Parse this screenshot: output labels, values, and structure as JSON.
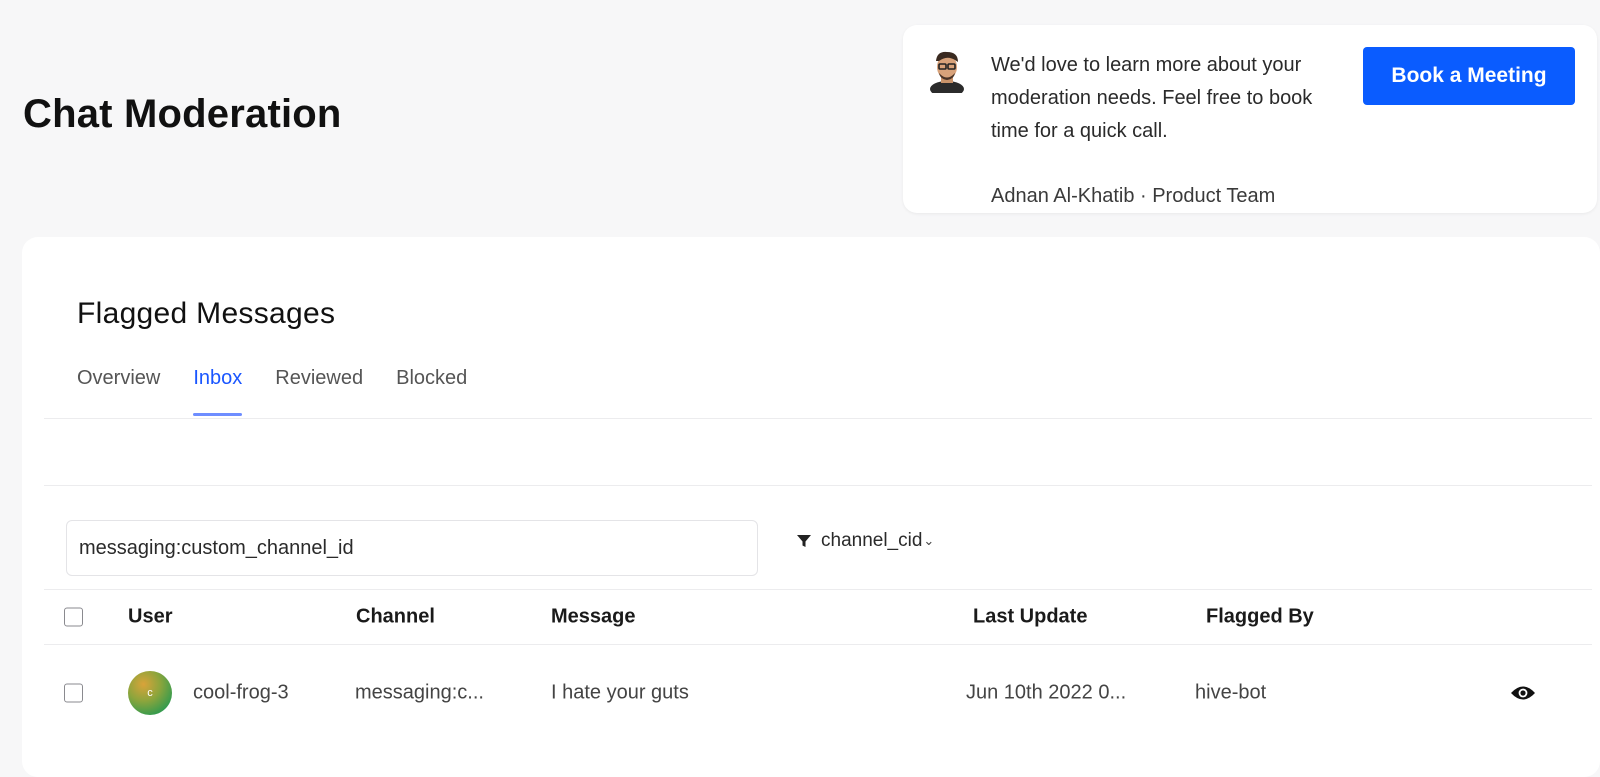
{
  "page": {
    "title": "Chat Moderation"
  },
  "promo": {
    "avatar_icon": "person-avatar",
    "message": "We'd love to learn more about your moderation needs. Feel free to book time for a quick call.",
    "author": "Adnan Al-Khatib · Product Team",
    "button_label": "Book a Meeting",
    "button_color": "#0a5cff"
  },
  "flagged": {
    "title": "Flagged Messages",
    "tabs": [
      {
        "label": "Overview",
        "active": false
      },
      {
        "label": "Inbox",
        "active": true
      },
      {
        "label": "Reviewed",
        "active": false
      },
      {
        "label": "Blocked",
        "active": false
      }
    ],
    "filter": {
      "value": "messaging:custom_channel_id",
      "field_label": "channel_cid",
      "field_icon": "funnel-icon"
    },
    "table": {
      "columns": [
        "User",
        "Channel",
        "Message",
        "Last Update",
        "Flagged By"
      ],
      "rows": [
        {
          "avatar_initial": "c",
          "user": "cool-frog-3",
          "channel": "messaging:c...",
          "message": "I hate your guts",
          "last_update": "Jun 10th 2022 0...",
          "flagged_by": "hive-bot",
          "action_icon": "eye-icon"
        }
      ]
    }
  },
  "colors": {
    "accent": "#1a56ff",
    "background": "#f7f7f8"
  }
}
